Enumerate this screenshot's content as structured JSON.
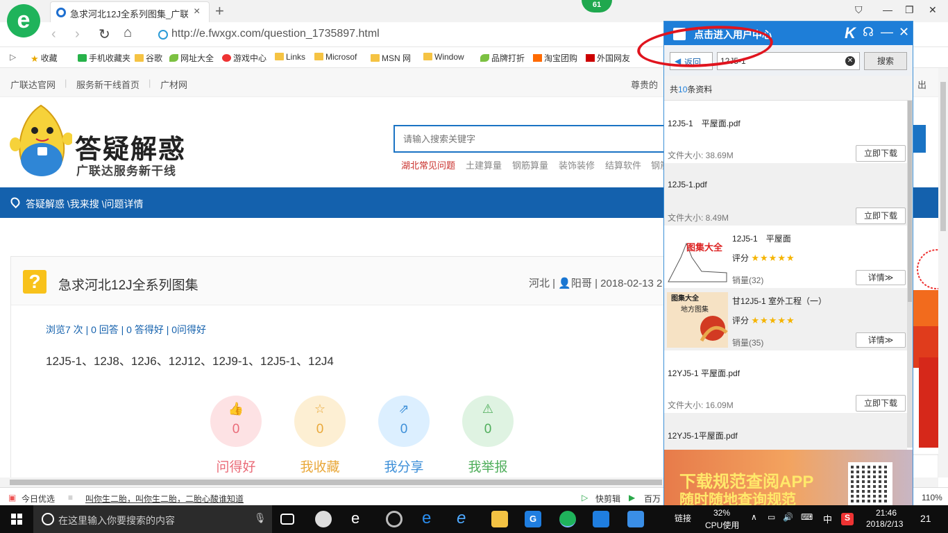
{
  "browser": {
    "tab_title": "急求河北12J全系列图集_广联达服",
    "tab_close": "×",
    "new_tab": "+",
    "badge": "61",
    "url": "http://e.fwxgx.com/question_1735897.html",
    "favorites": [
      {
        "label": "收藏",
        "icon": "star"
      },
      {
        "label": "手机收藏夹",
        "icon": "green"
      },
      {
        "label": "谷歌",
        "icon": "folder"
      },
      {
        "label": "网址大全",
        "icon": "leaf"
      },
      {
        "label": "游戏中心",
        "icon": "round-red"
      },
      {
        "label": "Links",
        "icon": "folder"
      },
      {
        "label": "Microsof",
        "icon": "folder"
      },
      {
        "label": "MSN 网",
        "icon": "folder"
      },
      {
        "label": "Window",
        "icon": "folder"
      },
      {
        "label": "品牌打折",
        "icon": "leaf"
      },
      {
        "label": "淘宝团购",
        "icon": "orange"
      },
      {
        "label": "外国网友",
        "icon": "red"
      }
    ]
  },
  "page": {
    "topnav": [
      "广联达官网",
      "服务新干线首页",
      "广材网"
    ],
    "topnav_right": "尊贵的",
    "topnav_logout": "出",
    "logo_main": "答疑解惑",
    "logo_sub": "广联达服务新干线",
    "search_placeholder": "请输入搜索关键字",
    "hotwords": [
      "湖北常见问题",
      "土建算量",
      "钢筋算量",
      "装饰装修",
      "结算软件",
      "钢筋"
    ],
    "breadcrumb": "答疑解惑 \\我来搜 \\问题详情",
    "question": {
      "icon": "?",
      "title": "急求河北12J全系列图集",
      "meta": "河北 | 👤阳哥 | 2018-02-13 2",
      "stats": "浏览7 次 | 0 回答 | 0 答得好 | 0问得好",
      "body": "12J5-1、12J8、12J6、12J12、12J9-1、12J5-1、12J4"
    },
    "actions": [
      {
        "label": "问得好",
        "count": "0",
        "glyph": "👍",
        "bg": "#fde2e4",
        "fg": "#ea6b78"
      },
      {
        "label": "我收藏",
        "count": "0",
        "glyph": "☆",
        "bg": "#fdefd3",
        "fg": "#e9a83a"
      },
      {
        "label": "我分享",
        "count": "0",
        "glyph": "⇗",
        "bg": "#dcefff",
        "fg": "#3d8fd8"
      },
      {
        "label": "我举报",
        "count": "0",
        "glyph": "⚠",
        "bg": "#dff3e2",
        "fg": "#4fae5b"
      }
    ]
  },
  "statusbar": {
    "left1": "今日优选",
    "left2": "叫你生二胎，叫你生二胎，二胎心酸谁知道",
    "mid1": "快剪辑",
    "mid2": "百万",
    "zoom": "110%"
  },
  "taskbar": {
    "search_placeholder": "在这里输入你要搜索的内容",
    "link_label": "链接",
    "cpu_percent": "32%",
    "cpu_label": "CPU使用",
    "ime": "中",
    "time": "21:46",
    "date": "2018/2/13",
    "notif_count": "21"
  },
  "popup": {
    "title": "点击进入用户中心",
    "k_logo": "K",
    "back_label": "返回",
    "search_value": "12J5-1",
    "search_button": "搜索",
    "count_prefix": "共",
    "count_num": "10",
    "count_suffix": "条资料",
    "files": [
      {
        "name": "12J5-1　平屋面.pdf",
        "size": "文件大小: 38.69M",
        "button": "立即下载"
      },
      {
        "name": "12J5-1.pdf",
        "size": "文件大小: 8.49M",
        "button": "立即下载"
      }
    ],
    "products": [
      {
        "name": "12J5-1　平屋面",
        "rating_label": "评分",
        "stars": "★★★★★",
        "sales": "销量(32)",
        "button": "详情≫",
        "thumb_text": "图集大全"
      },
      {
        "name": "甘12J5-1 室外工程（一）",
        "rating_label": "评分",
        "stars": "★★★★★",
        "sales": "销量(35)",
        "button": "详情≫",
        "thumb_text": "图集大全",
        "thumb_text2": "地方图集"
      }
    ],
    "files2": [
      {
        "name": "12YJ5-1 平屋面.pdf",
        "size": "文件大小: 16.09M",
        "button": "立即下载"
      },
      {
        "name": "12YJ5-1平屋面.pdf"
      }
    ],
    "banner_line1": "下载规范查阅APP",
    "banner_line2": "随时随地查询规范"
  },
  "colors": {
    "primary_blue": "#1461ad",
    "popup_blue": "#1e7ed8",
    "annotation_red": "#e0141e",
    "star_gold": "#f5b400"
  }
}
